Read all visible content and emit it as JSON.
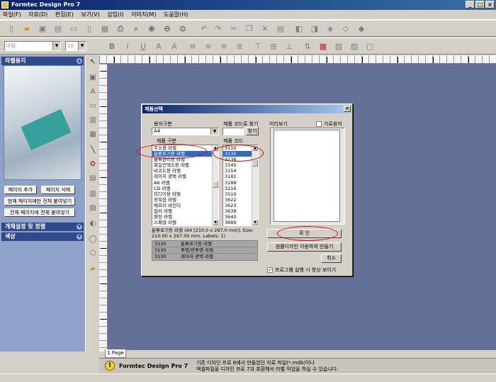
{
  "window": {
    "title": "Formtec Design Pro 7"
  },
  "menu": [
    "파일(F)",
    "자료(D)",
    "편집(E)",
    "보기(V)",
    "삽입(I)",
    "이미지(M)",
    "도움말(H)"
  ],
  "toolbar2": {
    "font_name": "바탕",
    "font_size": "10",
    "format_buttons": [
      "B",
      "I",
      "U",
      "A",
      "A"
    ]
  },
  "left_panel": {
    "title": "라벨용지",
    "buttons": {
      "add_page": "페이지 추가",
      "delete_page": "페이지 삭제",
      "paste_all_current": "현재 페이지에만 전체 붙여넣기",
      "paste_all_pages": "전체 페이지에 전체 붙여넣기"
    },
    "sections": [
      "개체설정 및 정렬",
      "색상"
    ]
  },
  "status": {
    "page_tab": "1 Page",
    "app_name": "Formtec Design Pro 7",
    "message_line1": "기존 디자인 프로 6에서 만들었던 자료 파일(*.mdb)이나",
    "message_line2": "엑셀파일을 디자인 프로 7과 호환해서 라벨 작업을 하실 수 있습니다."
  },
  "dialog": {
    "title": "제품선택",
    "paper_type_label": "용지구분",
    "paper_type_value": "A4",
    "product_kind_label": "제품 구분",
    "product_kinds": [
      "주소용 라벨",
      "분류표기용 라벨",
      "물류관리용 라벨",
      "화일인덱스용 라벨",
      "바코드용 라벨",
      "레이저 광택 라벨",
      "A6 라벨",
      "CD 라벨",
      "미디어용 라벨",
      "정육점 라벨",
      "메모리 바인더",
      "컬러 라벨",
      "향장 라벨",
      "스페셜 라벨"
    ],
    "selected_kind_index": 1,
    "search_label": "제품 코드로 찾기",
    "search_value": "",
    "search_button": "찾기",
    "code_label": "제품 코드",
    "codes": [
      "3110",
      "3130",
      "3136",
      "3145",
      "3154",
      "3181",
      "3189",
      "3216",
      "3510",
      "3622",
      "3623",
      "3639",
      "3640",
      "3680"
    ],
    "selected_code_index": 1,
    "preview_label": "미리보기",
    "landscape_label": "가로용지",
    "landscape_checked": false,
    "description": "분류표기용 라벨 (A4 [210.0 x 297.0 mm], Size: 210.00 x 297.00 mm, Labels: 1)",
    "results": [
      {
        "code": "3130",
        "name": "분류표기용 라벨"
      },
      {
        "code": "3130",
        "name": "투명/반투명 라벨"
      },
      {
        "code": "3130",
        "name": "레이저 광택 라벨"
      }
    ],
    "ok_button": "확 인",
    "sample_button": "샘플디자인 이용하여 만들기",
    "cancel_button": "취소",
    "startup_label": "프로그램 실행 시 항상 보이기",
    "startup_checked": true
  }
}
